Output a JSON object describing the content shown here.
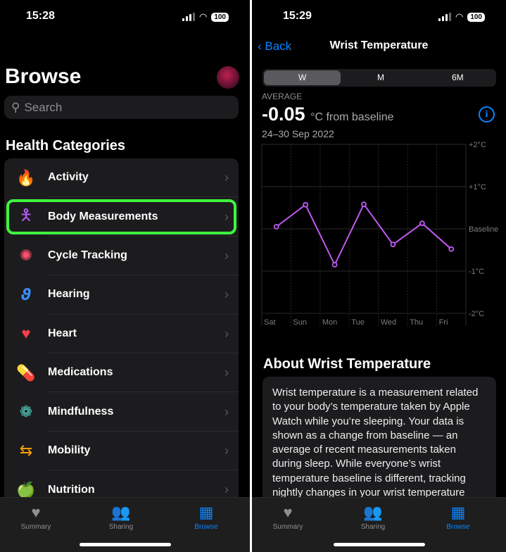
{
  "left": {
    "status": {
      "time": "15:28",
      "battery": "100"
    },
    "title": "Browse",
    "search_placeholder": "Search",
    "section": "Health Categories",
    "items": [
      {
        "label": "Activity",
        "icon": "flame-icon",
        "glyph": "🔥",
        "color": "#ff5a1f"
      },
      {
        "label": "Body Measurements",
        "icon": "figure-icon",
        "glyph": "🯅",
        "color": "#b45cf5",
        "highlighted": true
      },
      {
        "label": "Cycle Tracking",
        "icon": "cycle-icon",
        "glyph": "✺",
        "color": "#ff4f6d"
      },
      {
        "label": "Hearing",
        "icon": "ear-icon",
        "glyph": "𝟅",
        "color": "#3a8ef6"
      },
      {
        "label": "Heart",
        "icon": "heart-icon",
        "glyph": "♥",
        "color": "#ff3b4f"
      },
      {
        "label": "Medications",
        "icon": "pills-icon",
        "glyph": "💊",
        "color": "#5ac8fa"
      },
      {
        "label": "Mindfulness",
        "icon": "flower-icon",
        "glyph": "❁",
        "color": "#50d2c2"
      },
      {
        "label": "Mobility",
        "icon": "arrows-icon",
        "glyph": "⇆",
        "color": "#ff9f0a"
      },
      {
        "label": "Nutrition",
        "icon": "apple-icon",
        "glyph": "🍏",
        "color": "#34c759"
      }
    ]
  },
  "right": {
    "status": {
      "time": "15:29",
      "battery": "100"
    },
    "back": "Back",
    "nav_title": "Wrist Temperature",
    "segments": [
      "W",
      "M",
      "6M"
    ],
    "selected_segment": "W",
    "average_label": "AVERAGE",
    "average_value": "-0.05",
    "average_unit": "°C from baseline",
    "date_range": "24–30 Sep 2022",
    "about_title": "About Wrist Temperature",
    "about_text": "Wrist temperature is a measurement related to your body’s temperature taken by Apple Watch while you’re sleeping. Your data is shown as a change from baseline — an average of recent measurements taken during sleep. While everyone’s wrist temperature baseline is different, tracking nightly changes in your wrist temperature"
  },
  "tabs": [
    {
      "label": "Summary",
      "icon": "heart-icon"
    },
    {
      "label": "Sharing",
      "icon": "people-icon"
    },
    {
      "label": "Browse",
      "icon": "grid-icon",
      "active": true
    }
  ],
  "chart_data": {
    "type": "line",
    "categories": [
      "Sat",
      "Sun",
      "Mon",
      "Tue",
      "Wed",
      "Thu",
      "Fri"
    ],
    "values": [
      0.05,
      0.57,
      -0.85,
      0.58,
      -0.37,
      0.13,
      -0.48
    ],
    "y_ticks": [
      "+2°C",
      "+1°C",
      "Baseline",
      "-1°C",
      "-2°C"
    ],
    "ylim": [
      -2,
      2
    ],
    "color": "#bf5af2",
    "grid": true
  }
}
